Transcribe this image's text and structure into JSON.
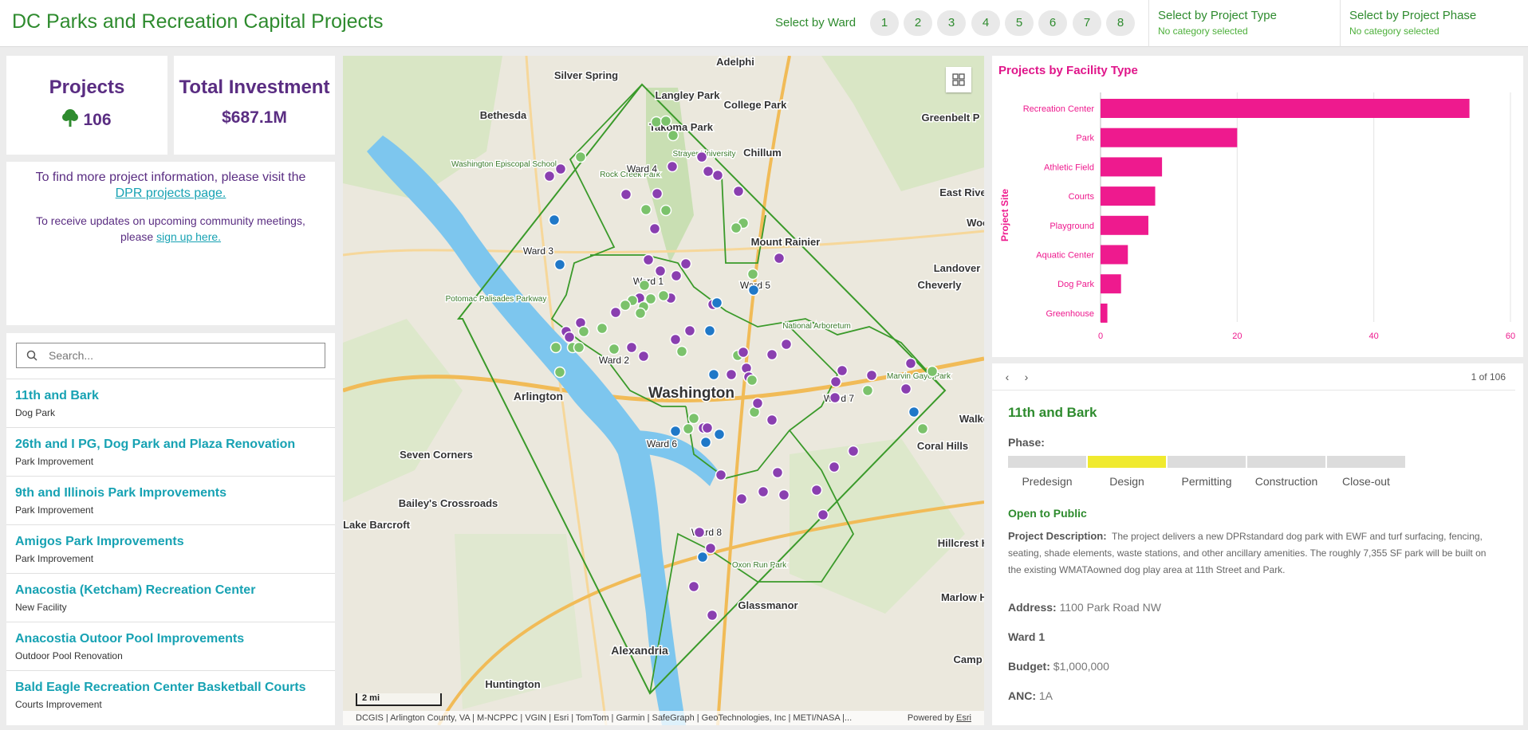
{
  "header": {
    "title": "DC Parks and Recreation Capital Projects",
    "ward_label": "Select by Ward",
    "wards": [
      "1",
      "2",
      "3",
      "4",
      "5",
      "6",
      "7",
      "8"
    ],
    "project_type": {
      "title": "Select by Project Type",
      "subtitle": "No category selected"
    },
    "project_phase": {
      "title": "Select by Project Phase",
      "subtitle": "No category selected"
    }
  },
  "stats": {
    "projects_label": "Projects",
    "projects_value": "106",
    "investment_label": "Total Investment",
    "investment_value": "$687.1M"
  },
  "info": {
    "line1": "To find more project information, please visit the",
    "link1": "DPR projects page.",
    "line2": "To receive updates on upcoming community meetings, please",
    "link2": "sign up here."
  },
  "search": {
    "placeholder": "Search..."
  },
  "projects": [
    {
      "name": "11th and Bark",
      "type": "Dog Park"
    },
    {
      "name": "26th and I PG, Dog Park and Plaza Renovation",
      "type": "Park Improvement"
    },
    {
      "name": "9th and Illinois Park Improvements",
      "type": "Park Improvement"
    },
    {
      "name": "Amigos Park Improvements",
      "type": "Park Improvement"
    },
    {
      "name": "Anacostia (Ketcham) Recreation Center",
      "type": "New Facility"
    },
    {
      "name": "Anacostia Outoor Pool Improvements",
      "type": "Outdoor Pool Renovation"
    },
    {
      "name": "Bald Eagle Recreation Center Basketball Courts",
      "type": "Courts Improvement"
    }
  ],
  "map": {
    "scale": "2 mi",
    "attribution": "DCGIS | Arlington County, VA | M-NCPPC | VGIN | Esri | TomTom | Garmin | SafeGraph | GeoTechnologies, Inc | METI/NASA |...",
    "powered_by": "Powered by",
    "esri": "Esri",
    "places": [
      "Silver Spring",
      "Adelphi",
      "Langley Park",
      "College Park",
      "Takoma Park",
      "Bethesda",
      "Chillum",
      "Greenbelt P",
      "Mount Rainier",
      "East Riverdale",
      "Landover",
      "Cheverly",
      "Arlington",
      "Washington",
      "Walker",
      "Seven Corners",
      "Coral Hills",
      "Bailey's Crossroads",
      "Lake Barcroft",
      "Hillcrest Heights",
      "Marlow Heights",
      "Glassmanor",
      "Alexandria",
      "Huntington",
      "Camp Sprin",
      "Washington Episcopal School",
      "Rock Creek Park",
      "Potomac Palisades Parkway",
      "National Arboretum",
      "Oxon Run Park",
      "Marvin Gaye Park",
      "Strayer University",
      "Wood"
    ],
    "wards": [
      "Ward 1",
      "Ward 2",
      "Ward 3",
      "Ward 4",
      "Ward 5",
      "Ward 6",
      "Ward 7",
      "Ward 8"
    ],
    "colors": {
      "boundary": "#3a9a2a",
      "water": "#7dc6ee",
      "purple": "#8a3fb0",
      "green": "#7bc26b",
      "blue": "#1f78c8"
    }
  },
  "chart_data": {
    "type": "bar",
    "orientation": "horizontal",
    "title": "Projects by Facility Type",
    "ylabel": "Project Site",
    "categories": [
      "Recreation Center",
      "Park",
      "Athletic Field",
      "Courts",
      "Playground",
      "Aquatic Center",
      "Dog Park",
      "Greenhouse"
    ],
    "values": [
      54,
      20,
      9,
      8,
      7,
      4,
      3,
      1
    ],
    "xlim": [
      0,
      60
    ],
    "xticks": [
      "0",
      "20",
      "40",
      "60"
    ],
    "color": "#ee1a8e"
  },
  "detail": {
    "prev_icon": "chevron-left-icon",
    "next_icon": "chevron-right-icon",
    "page": "1 of 106",
    "title": "11th and Bark",
    "phase_label": "Phase:",
    "phases": [
      "Predesign",
      "Design",
      "Permitting",
      "Construction",
      "Close-out"
    ],
    "active_phase": "Design",
    "status": "Open to Public",
    "desc_label": "Project Description:",
    "description": "The project delivers a new DPRstandard dog park with EWF and turf surfacing, fencing, seating, shade elements, waste stations, and other ancillary amenities. The roughly 7,355 SF park will be built on the existing WMATAowned dog play area at 11th Street and Park.",
    "address_label": "Address:",
    "address": "1100 Park Road NW",
    "ward": "Ward 1",
    "budget_label": "Budget:",
    "budget": "$1,000,000",
    "anc_label": "ANC:",
    "anc": "1A"
  }
}
